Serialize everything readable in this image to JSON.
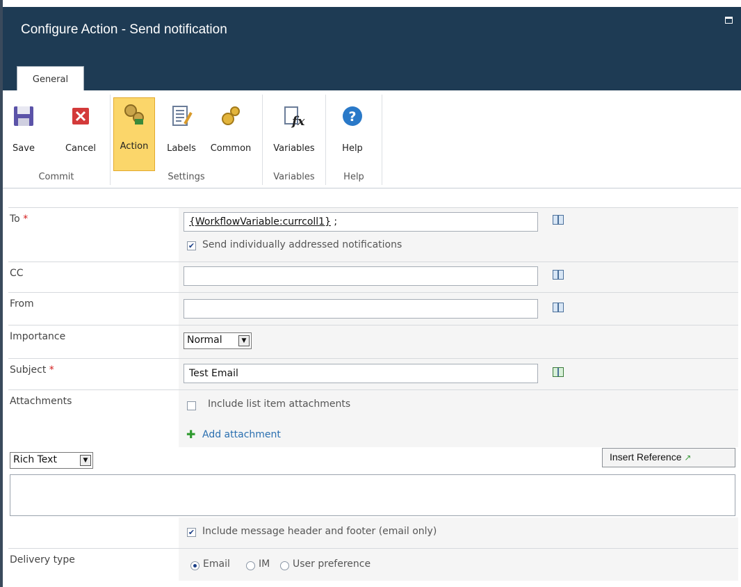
{
  "window": {
    "title": "Configure Action - Send notification"
  },
  "tabs": [
    {
      "label": "General"
    }
  ],
  "ribbon": {
    "groups": [
      {
        "label": "Commit",
        "buttons": [
          {
            "label": "Save",
            "icon": "save-icon"
          },
          {
            "label": "Cancel",
            "icon": "cancel-icon"
          }
        ]
      },
      {
        "label": "Settings",
        "buttons": [
          {
            "label": "Action",
            "icon": "action-gears-icon",
            "selected": true
          },
          {
            "label": "Labels",
            "icon": "labels-icon"
          },
          {
            "label": "Common",
            "icon": "common-gears-icon"
          }
        ]
      },
      {
        "label": "Variables",
        "buttons": [
          {
            "label": "Variables",
            "icon": "variables-fx-icon"
          }
        ]
      },
      {
        "label": "Help",
        "buttons": [
          {
            "label": "Help",
            "icon": "help-icon"
          }
        ]
      }
    ]
  },
  "form": {
    "to": {
      "label": "To",
      "value": "{WorkflowVariable:currcoll1}",
      "suffix": " ;",
      "individual_label": "Send individually addressed notifications",
      "individual_checked": true
    },
    "cc": {
      "label": "CC",
      "value": ""
    },
    "from": {
      "label": "From",
      "value": ""
    },
    "importance": {
      "label": "Importance",
      "value": "Normal"
    },
    "subject": {
      "label": "Subject",
      "value": "Test Email"
    },
    "attachments": {
      "label": "Attachments",
      "include_label": "Include list item attachments",
      "include_checked": false,
      "add_label": "Add attachment"
    },
    "body": {
      "format": "Rich Text",
      "insert_reference_label": "Insert Reference"
    },
    "header_footer": {
      "label": "Include message header and footer (email only)",
      "checked": true
    },
    "delivery": {
      "label": "Delivery type",
      "options": [
        "Email",
        "IM",
        "User preference"
      ],
      "selected": "Email"
    },
    "required_mark": "*"
  },
  "colors": {
    "title_bg": "#1e3b54",
    "selected_button": "#fbd66a",
    "link": "#2a6fb0",
    "required": "#d31b1b"
  }
}
